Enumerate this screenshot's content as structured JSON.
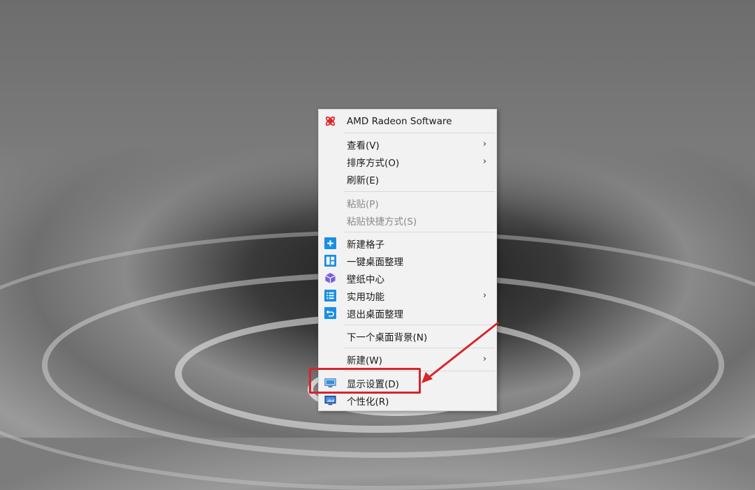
{
  "menu": {
    "amd": {
      "label": "AMD Radeon Software",
      "icon": "amd-radeon-icon"
    },
    "view": {
      "label": "查看(V)"
    },
    "sort": {
      "label": "排序方式(O)"
    },
    "refresh": {
      "label": "刷新(E)"
    },
    "paste": {
      "label": "粘贴(P)"
    },
    "paste_shortcut": {
      "label": "粘贴快捷方式(S)"
    },
    "new_grid": {
      "label": "新建格子",
      "icon": "plus-icon"
    },
    "one_click_organize": {
      "label": "一键桌面整理",
      "icon": "layout-icon"
    },
    "wallpaper_center": {
      "label": "壁纸中心",
      "icon": "cube-icon"
    },
    "utilities": {
      "label": "实用功能",
      "icon": "list-icon"
    },
    "exit_organize": {
      "label": "退出桌面整理",
      "icon": "exit-icon"
    },
    "next_background": {
      "label": "下一个桌面背景(N)"
    },
    "new": {
      "label": "新建(W)"
    },
    "display_settings": {
      "label": "显示设置(D)",
      "icon": "monitor-icon"
    },
    "personalize": {
      "label": "个性化(R)",
      "icon": "personalize-icon"
    },
    "submenu_arrow": "›"
  },
  "colors": {
    "menu_bg": "#f2f2f2",
    "accent_blue": "#1a8fe3",
    "annotation_red": "#d4262d",
    "amd_red": "#e3262e",
    "purple": "#7b5fe0"
  }
}
